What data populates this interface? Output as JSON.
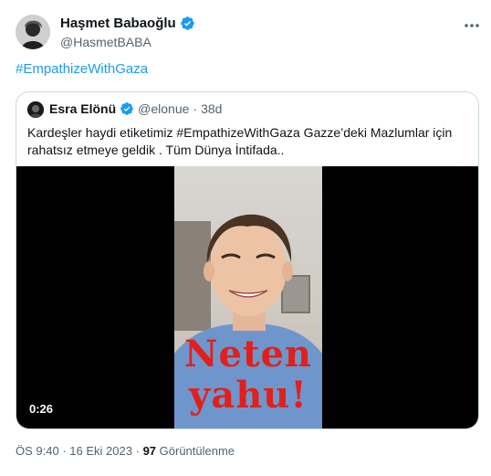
{
  "author": {
    "name": "Haşmet Babaoğlu",
    "handle": "@HasmetBABA"
  },
  "tweet": {
    "hashtag": "#EmpathizeWithGaza"
  },
  "quoted": {
    "name": "Esra Elönü",
    "handle": "@elonue",
    "separator": "·",
    "time": "38d",
    "text": "Kardeşler haydi etiketimiz #EmpathizeWithGaza  Gazze’deki Mazlumlar için rahatsız etmeye geldik . Tüm Dünya İntifada..",
    "video": {
      "duration": "0:26",
      "caption_line1": "Neten",
      "caption_line2": "yahu!"
    }
  },
  "meta": {
    "time": "ÖS 9:40",
    "separator": "·",
    "date": "16 Eki 2023",
    "views_count": "97",
    "views_label": "Görüntülenme"
  },
  "icons": {
    "verified": "verified-badge-icon",
    "more": "more-icon"
  },
  "colors": {
    "accent": "#1d9bf0",
    "caption": "#e0201c"
  }
}
